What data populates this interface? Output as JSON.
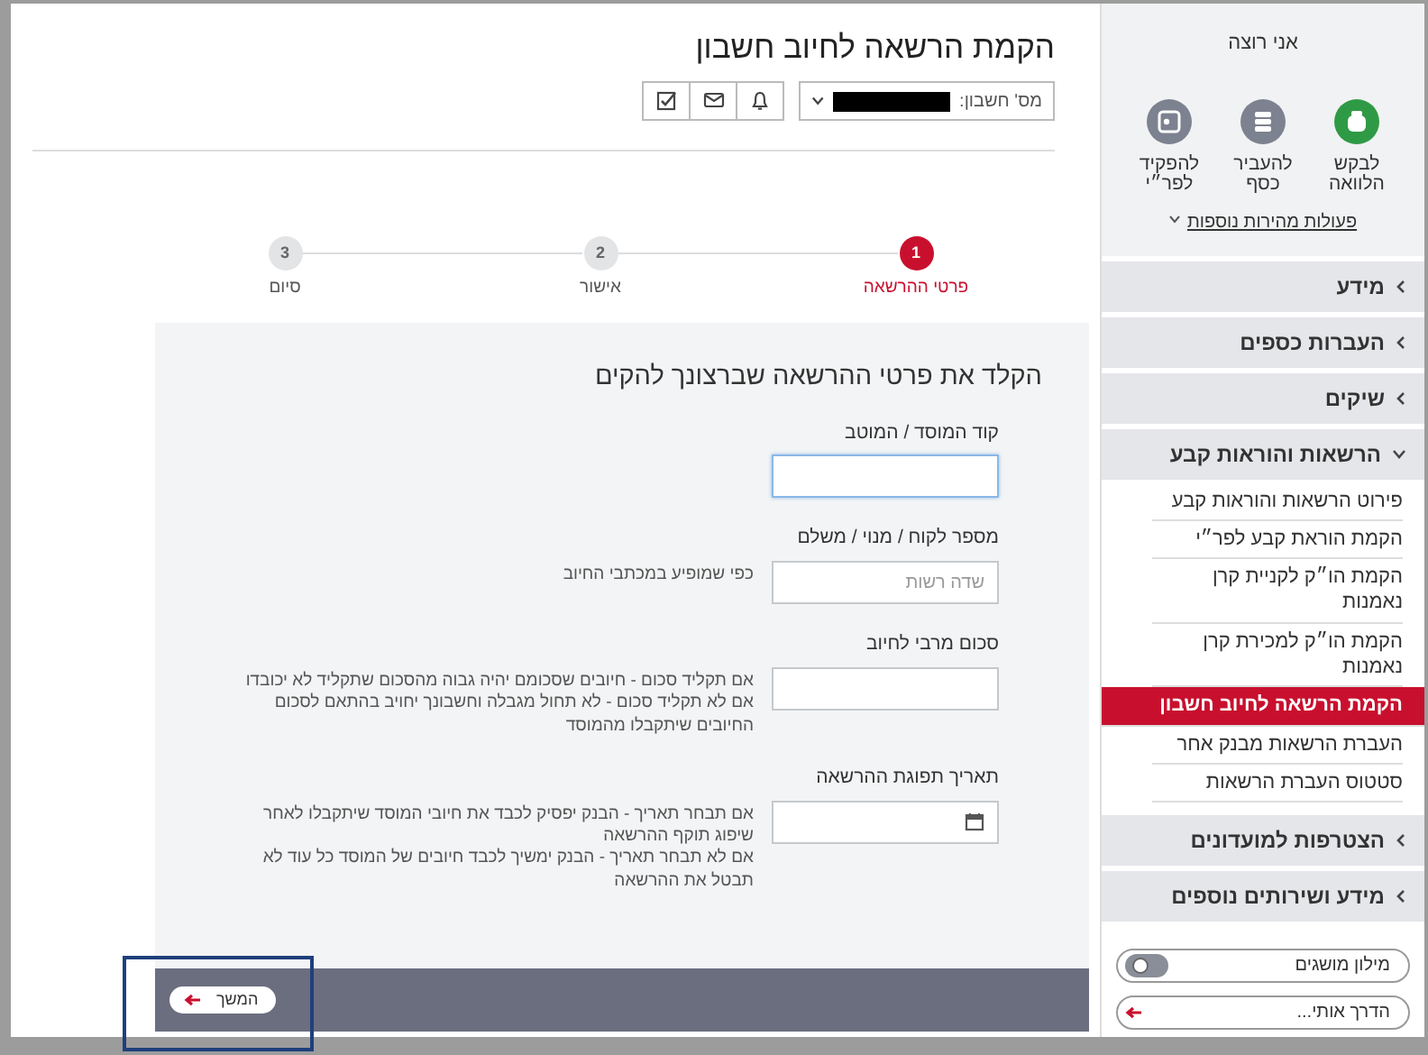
{
  "page_title": "הקמת הרשאה לחיוב חשבון",
  "account_selector": {
    "label": "מס' חשבון:",
    "redacted": true
  },
  "steps": [
    {
      "number": "1",
      "label": "פרטי ההרשאה",
      "selected": true
    },
    {
      "number": "2",
      "label": "אישור",
      "selected": false
    },
    {
      "number": "3",
      "label": "סיום",
      "selected": false
    }
  ],
  "form": {
    "heading": "הקלד את פרטי ההרשאה שברצונך להקים",
    "fields": [
      {
        "label": "קוד המוסד / המוטב",
        "kind": "text",
        "focused": true
      },
      {
        "label": "מספר לקוח / מנוי / משלם",
        "kind": "text",
        "focused": false,
        "placeholder": "שדה רשות",
        "help": [
          "כפי שמופיע במכתבי החיוב"
        ]
      },
      {
        "label": "סכום מרבי לחיוב",
        "kind": "text",
        "focused": false,
        "help": [
          "אם תקליד סכום - חיובים שסכומם יהיה גבוה מהסכום שתקליד לא יכובדו",
          "אם לא תקליד סכום - לא תחול מגבלה וחשבונך יחויב בהתאם לסכום החיובים שיתקבלו מהמוסד"
        ]
      },
      {
        "label": "תאריך תפוגת ההרשאה",
        "kind": "date",
        "focused": false,
        "help": [
          "אם תבחר תאריך - הבנק יפסיק לכבד את חיובי המוסד שיתקבלו לאחר שיפוג תוקף ההרשאה",
          "אם לא תבחר תאריך - הבנק ימשיך לכבד חיובים של המוסד כל עוד לא תבטל את ההרשאה"
        ]
      }
    ]
  },
  "footer": {
    "continue_button": {
      "label": "המשך",
      "highlighted": true
    }
  },
  "sidebar": {
    "heading": "אני רוצה",
    "quick_actions": [
      {
        "label": "לבקש הלוואה",
        "color": "#2f9a45"
      },
      {
        "label": "להעביר כסף",
        "color": "#7d8290"
      },
      {
        "label": "להפקיד לפר״י",
        "color": "#7d8290"
      }
    ],
    "more_link": "פעולות מהירות נוספות",
    "menu": [
      {
        "label": "מידע",
        "expanded": false
      },
      {
        "label": "העברות כספים",
        "expanded": false
      },
      {
        "label": "שיקים",
        "expanded": false
      },
      {
        "label": "הרשאות והוראות קבע",
        "expanded": true,
        "children": [
          {
            "label": "פירוט הרשאות והוראות קבע",
            "selected": false
          },
          {
            "label": "הקמת הוראת קבע לפר״י",
            "selected": false
          },
          {
            "label": "הקמת הו״ק לקניית קרן נאמנות",
            "selected": false
          },
          {
            "label": "הקמת הו״ק למכירת קרן נאמנות",
            "selected": false
          },
          {
            "label": "הקמת הרשאה לחיוב חשבון",
            "selected": true
          },
          {
            "label": "העברת הרשאות מבנק אחר",
            "selected": false
          },
          {
            "label": "סטטוס העברת הרשאות",
            "selected": false
          }
        ]
      },
      {
        "label": "הצטרפות למועדונים",
        "expanded": false
      },
      {
        "label": "מידע ושירותים נוספים",
        "expanded": false
      }
    ],
    "glossary": {
      "label": "מילון מושגים",
      "on": false
    },
    "guide": {
      "label": "הדרך אותי..."
    }
  }
}
